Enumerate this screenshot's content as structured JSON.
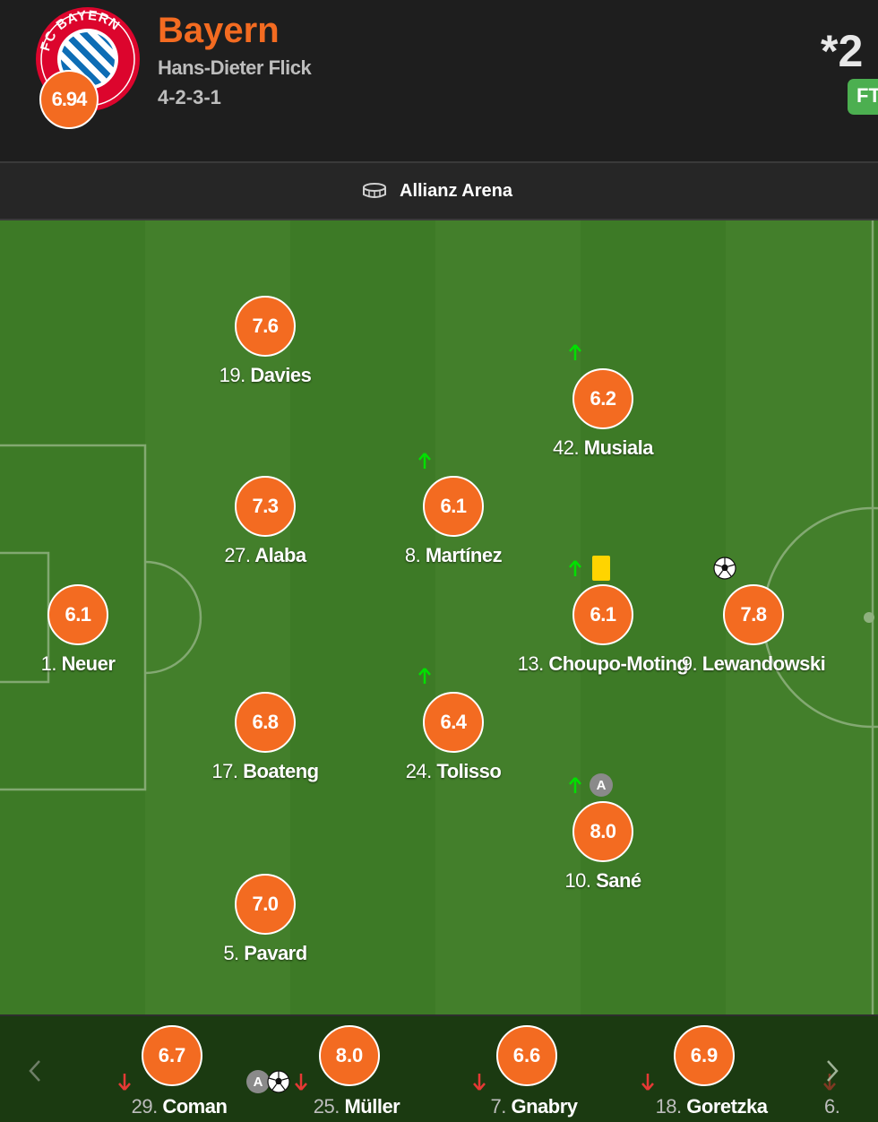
{
  "header": {
    "team_name": "Bayern",
    "coach": "Hans-Dieter Flick",
    "formation": "4-2-3-1",
    "team_rating": "6.94",
    "crest_text": "FC BAYERN MÜNCHEN",
    "score_partial": "*2 :",
    "status": "FT"
  },
  "venue": {
    "name": "Allianz Arena",
    "icon": "stadium-icon"
  },
  "colors": {
    "accent": "#f36b21",
    "pitch_dark": "#3d7a26",
    "pitch_light": "#437f2b",
    "sub_in": "#00e000",
    "sub_out": "#e53935",
    "yellow_card": "#ffd400",
    "status_green": "#4caf50"
  },
  "lineup": [
    {
      "id": "neuer",
      "number": "1.",
      "name": "Neuer",
      "rating": "6.1"
    },
    {
      "id": "davies",
      "number": "19.",
      "name": "Davies",
      "rating": "7.6"
    },
    {
      "id": "alaba",
      "number": "27.",
      "name": "Alaba",
      "rating": "7.3"
    },
    {
      "id": "boateng",
      "number": "17.",
      "name": "Boateng",
      "rating": "6.8"
    },
    {
      "id": "pavard",
      "number": "5.",
      "name": "Pavard",
      "rating": "7.0"
    },
    {
      "id": "martinez",
      "number": "8.",
      "name": "Martínez",
      "rating": "6.1",
      "subbed_off": true
    },
    {
      "id": "tolisso",
      "number": "24.",
      "name": "Tolisso",
      "rating": "6.4",
      "subbed_off": true
    },
    {
      "id": "musiala",
      "number": "42.",
      "name": "Musiala",
      "rating": "6.2",
      "subbed_off": true
    },
    {
      "id": "choupo",
      "number": "13.",
      "name": "Choupo-Moting",
      "rating": "6.1",
      "subbed_off": true,
      "yellow_card": true
    },
    {
      "id": "sane",
      "number": "10.",
      "name": "Sané",
      "rating": "8.0",
      "subbed_off": true,
      "captain_badge": "A"
    },
    {
      "id": "lewandowski",
      "number": "9.",
      "name": "Lewandowski",
      "rating": "7.8",
      "goal": true
    }
  ],
  "substitutes": [
    {
      "id": "coman",
      "number": "29.",
      "name": "Coman",
      "rating": "6.7"
    },
    {
      "id": "muller",
      "number": "25.",
      "name": "Müller",
      "rating": "8.0",
      "captain_badge": "A",
      "goal": true
    },
    {
      "id": "gnabry",
      "number": "7.",
      "name": "Gnabry",
      "rating": "6.6"
    },
    {
      "id": "goretzka",
      "number": "18.",
      "name": "Goretzka",
      "rating": "6.9"
    },
    {
      "id": "partial",
      "number": "6.",
      "name": "",
      "rating": ""
    }
  ]
}
